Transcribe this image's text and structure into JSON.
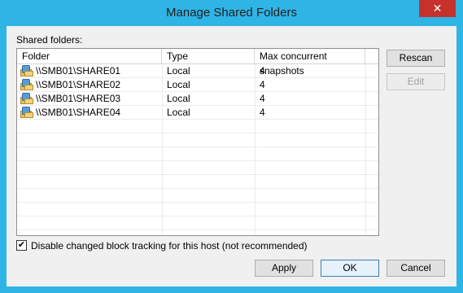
{
  "window": {
    "title": "Manage Shared Folders",
    "close_glyph": "✕"
  },
  "shared_folders_label": "Shared folders:",
  "grid": {
    "columns": [
      "Folder",
      "Type",
      "Max concurrent snapshots"
    ],
    "rows": [
      {
        "folder": "\\\\SMB01\\SHARE01",
        "type": "Local",
        "max": "4",
        "icon": "shared-folder-icon"
      },
      {
        "folder": "\\\\SMB01\\SHARE02",
        "type": "Local",
        "max": "4",
        "icon": "shared-folder-icon"
      },
      {
        "folder": "\\\\SMB01\\SHARE03",
        "type": "Local",
        "max": "4",
        "icon": "shared-folder-icon"
      },
      {
        "folder": "\\\\SMB01\\SHARE04",
        "type": "Local",
        "max": "4",
        "icon": "shared-folder-icon"
      }
    ]
  },
  "buttons": {
    "rescan": "Rescan",
    "edit": "Edit",
    "apply": "Apply",
    "ok": "OK",
    "cancel": "Cancel"
  },
  "checkbox": {
    "label": "Disable changed block tracking for this host (not recommended)",
    "checked": true,
    "mark": "✔"
  },
  "colors": {
    "title_bar": "#2fb4e6",
    "close_button": "#c7312b",
    "dialog_bg": "#f0f0f0"
  }
}
